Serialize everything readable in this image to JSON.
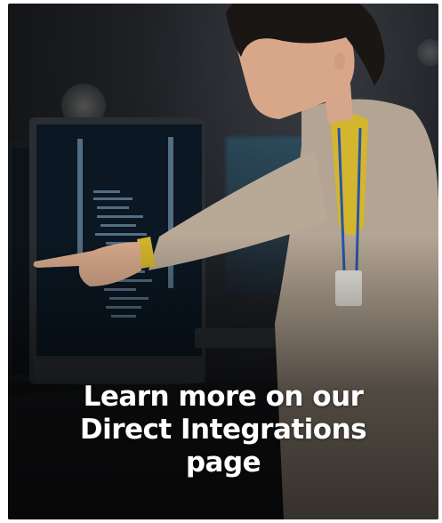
{
  "banner": {
    "image_alt": "Woman pointing at code on a computer monitor",
    "headline_lines": [
      "Learn more on our",
      "Direct Integrations",
      "page"
    ]
  },
  "colors": {
    "text": "#ffffff",
    "jacket": "#b9aa99",
    "shirt": "#d8b92f"
  },
  "icons": {
    "person": "person-pointing-illustration",
    "monitor": "computer-monitor-illustration"
  }
}
